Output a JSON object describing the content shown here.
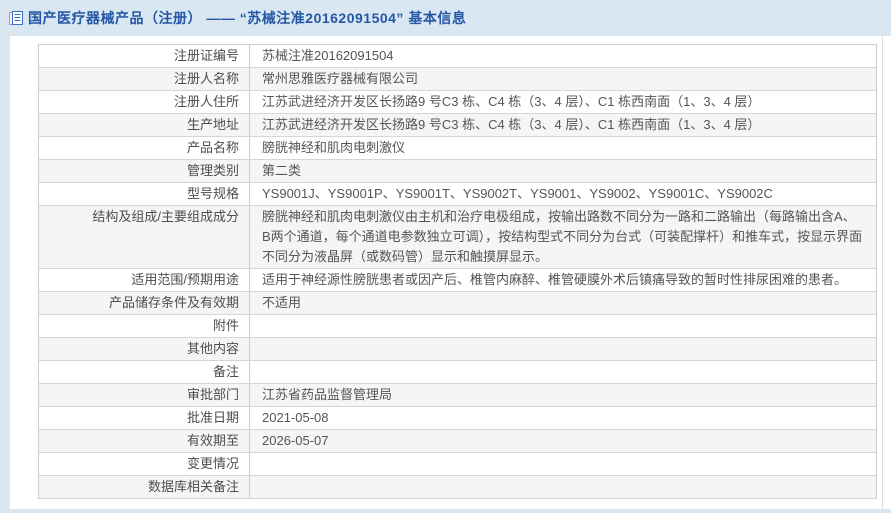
{
  "colors": {
    "page_background": "#d9e7f3",
    "title_blue": "#2456a4",
    "row_stripe": "#f5f5f5",
    "table_border": "#cccccc",
    "text_gray": "#555555"
  },
  "header": {
    "icon": "document-icon",
    "title": "国产医疗器械产品（注册） —— “苏械注准20162091504” 基本信息"
  },
  "table": {
    "rows": [
      {
        "label": "注册证编号",
        "value": "苏械注准20162091504"
      },
      {
        "label": "注册人名称",
        "value": "常州思雅医疗器械有限公司"
      },
      {
        "label": "注册人住所",
        "value": "江苏武进经济开发区长扬路9 号C3 栋、C4 栋（3、4 层）、C1 栋西南面（1、3、4 层）"
      },
      {
        "label": "生产地址",
        "value": "江苏武进经济开发区长扬路9 号C3 栋、C4 栋（3、4 层）、C1 栋西南面（1、3、4 层）"
      },
      {
        "label": "产品名称",
        "value": "膀胱神经和肌肉电刺激仪"
      },
      {
        "label": "管理类别",
        "value": "第二类"
      },
      {
        "label": "型号规格",
        "value": "YS9001J、YS9001P、YS9001T、YS9002T、YS9001、YS9002、YS9001C、YS9002C"
      },
      {
        "label": "结构及组成/主要组成成分",
        "value": "膀胱神经和肌肉电刺激仪由主机和治疗电极组成，按输出路数不同分为一路和二路输出（每路输出含A、B两个通道，每个通道电参数独立可调），按结构型式不同分为台式（可装配撑杆）和推车式，按显示界面不同分为液晶屏（或数码管）显示和触摸屏显示。"
      },
      {
        "label": "适用范围/预期用途",
        "value": "适用于神经源性膀胱患者或因产后、椎管内麻醉、椎管硬膜外术后镇痛导致的暂时性排尿困难的患者。"
      },
      {
        "label": "产品储存条件及有效期",
        "value": "不适用"
      },
      {
        "label": "附件",
        "value": ""
      },
      {
        "label": "其他内容",
        "value": ""
      },
      {
        "label": "备注",
        "value": ""
      },
      {
        "label": "审批部门",
        "value": "江苏省药品监督管理局"
      },
      {
        "label": "批准日期",
        "value": "2021-05-08"
      },
      {
        "label": "有效期至",
        "value": "2026-05-07"
      },
      {
        "label": "变更情况",
        "value": ""
      },
      {
        "label": "数据库相关备注",
        "value": ""
      }
    ]
  }
}
